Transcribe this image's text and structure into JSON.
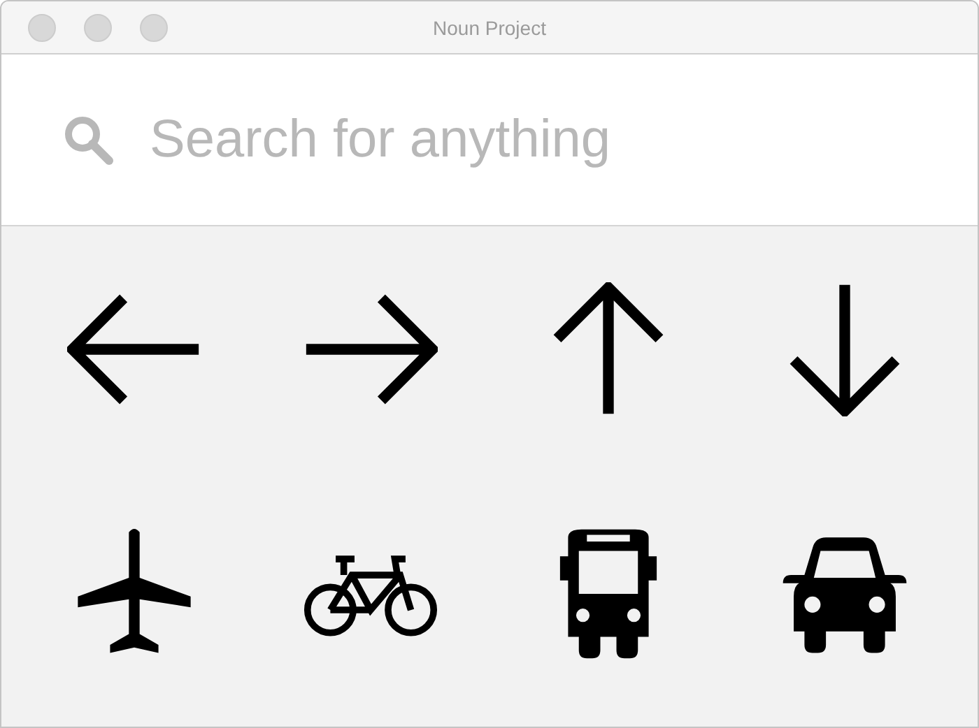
{
  "window": {
    "title": "Noun Project"
  },
  "search": {
    "placeholder": "Search for anything"
  },
  "icons": [
    {
      "kind": "arrow-left"
    },
    {
      "kind": "arrow-right"
    },
    {
      "kind": "arrow-up"
    },
    {
      "kind": "arrow-down"
    },
    {
      "kind": "plane"
    },
    {
      "kind": "bicycle"
    },
    {
      "kind": "bus"
    },
    {
      "kind": "car"
    }
  ]
}
